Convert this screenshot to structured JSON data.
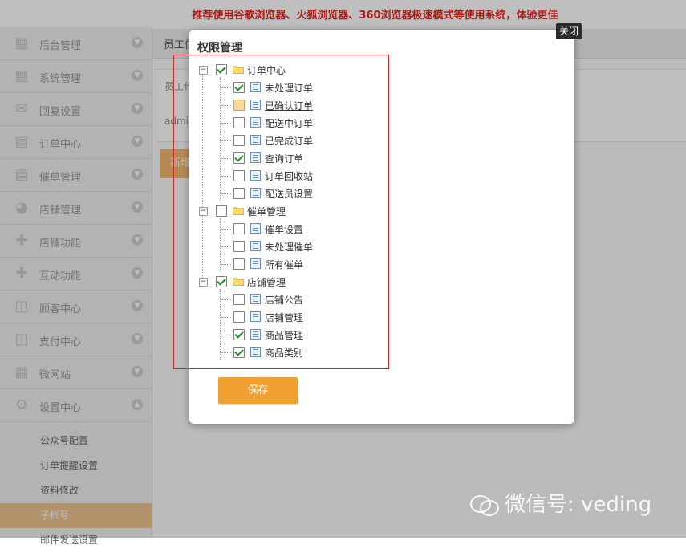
{
  "notice": "推荐使用谷歌浏览器、火狐浏览器、360浏览器极速模式等使用系统，体验更佳",
  "sidebar": {
    "items": [
      {
        "label": "后台管理",
        "icon": "grid-icon"
      },
      {
        "label": "系统管理",
        "icon": "grid-icon"
      },
      {
        "label": "回复设置",
        "icon": "mail-icon"
      },
      {
        "label": "订单中心",
        "icon": "printer-icon"
      },
      {
        "label": "催单管理",
        "icon": "printer-icon"
      },
      {
        "label": "店铺管理",
        "icon": "pie-icon"
      },
      {
        "label": "店铺功能",
        "icon": "plus-icon"
      },
      {
        "label": "互动功能",
        "icon": "plus-icon"
      },
      {
        "label": "顾客中心",
        "icon": "inbox-icon"
      },
      {
        "label": "支付中心",
        "icon": "inbox-icon"
      },
      {
        "label": "微网站",
        "icon": "grid-icon"
      },
      {
        "label": "设置中心",
        "icon": "gear-icon"
      }
    ],
    "subitems": [
      {
        "label": "公众号配置"
      },
      {
        "label": "订单提醒设置"
      },
      {
        "label": "资料修改"
      },
      {
        "label": "子帐号"
      },
      {
        "label": "邮件发送设置"
      }
    ]
  },
  "main": {
    "tab": "员工信",
    "row1": "员工代",
    "row2": "admin",
    "add_button": "新增"
  },
  "modal": {
    "title": "权限管理",
    "close": "关闭",
    "save": "保存",
    "tree": {
      "order_center": {
        "label": "订单中心",
        "children": [
          "未处理订单",
          "已确认订单",
          "配送中订单",
          "已完成订单",
          "查询订单",
          "订单回收站",
          "配送员设置"
        ]
      },
      "urge": {
        "label": "催单管理",
        "children": [
          "催单设置",
          "未处理催单",
          "所有催单"
        ]
      },
      "shop": {
        "label": "店铺管理",
        "children": [
          "店铺公告",
          "店铺管理",
          "商品管理",
          "商品类别"
        ]
      }
    }
  },
  "watermark": "微信号: veding"
}
